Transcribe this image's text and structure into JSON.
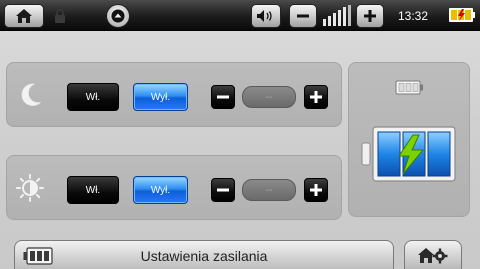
{
  "status_bar": {
    "home": "home-icon",
    "lock": "lock-icon",
    "up": "up-arrow-icon",
    "volume": "speaker-icon",
    "volume_down": "minus-icon",
    "volume_up": "plus-icon",
    "volume_level": 0.9,
    "time": "13:32",
    "battery": "battery-charging-icon"
  },
  "night_row": {
    "icon": "moon-icon",
    "on_label": "Wł.",
    "off_label": "Wył.",
    "selected": "off",
    "value": "--"
  },
  "day_row": {
    "icon": "sun-brightness-icon",
    "on_label": "Wł.",
    "off_label": "Wył.",
    "selected": "off",
    "value": "--"
  },
  "battery_panel": {
    "small_icon": "battery-empty-icon",
    "big_icon": "battery-charging-icon",
    "charge_level": 1.0
  },
  "footer": {
    "title": "Ustawienia zasilania",
    "icon": "battery-icon",
    "settings": "gear-home-icon"
  },
  "colors": {
    "accent": "#1e7ff0",
    "bolt": "#7bd400"
  }
}
